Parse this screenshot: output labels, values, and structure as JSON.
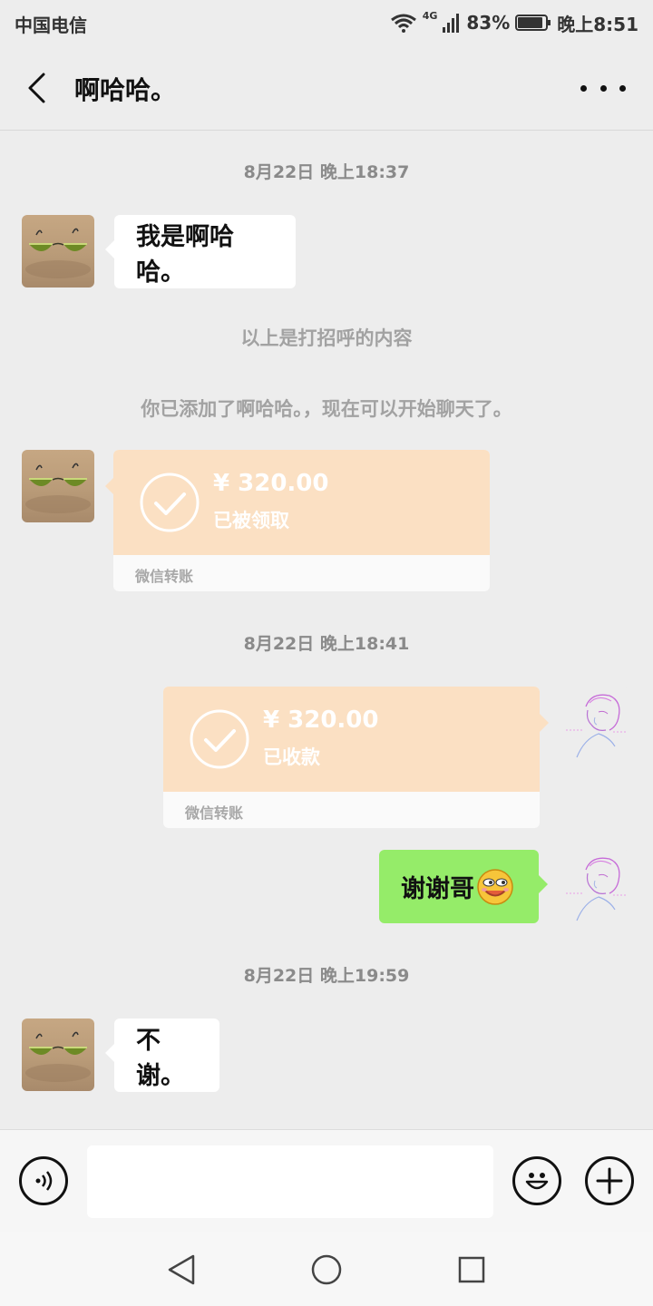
{
  "status_bar": {
    "carrier": "中国电信",
    "network": "4G",
    "battery": "83%",
    "time": "晚上8:51"
  },
  "header": {
    "title": "啊哈哈。",
    "back_icon": "chevron-left-icon",
    "more_icon": "more-dots-icon"
  },
  "messages": {
    "ts1": "8月22日 晚上18:37",
    "msg1": "我是啊哈哈。",
    "sys1": "以上是打招呼的内容",
    "sys2": "你已添加了啊哈哈。，现在可以开始聊天了。",
    "transfer1": {
      "amount": "¥ 320.00",
      "status": "已被领取",
      "label": "微信转账"
    },
    "ts2": "8月22日 晚上18:41",
    "transfer2": {
      "amount": "¥ 320.00",
      "status": "已收款",
      "label": "微信转账"
    },
    "msg2": "谢谢哥",
    "ts3": "8月22日 晚上19:59",
    "msg3": "不谢。"
  },
  "input": {
    "voice_icon": "voice-icon",
    "emoji_icon": "emoji-icon",
    "plus_icon": "plus-icon",
    "placeholder": ""
  },
  "colors": {
    "background": "#ededed",
    "my_bubble": "#95ec69",
    "their_bubble": "#ffffff",
    "transfer_card": "#fbe0c3"
  }
}
